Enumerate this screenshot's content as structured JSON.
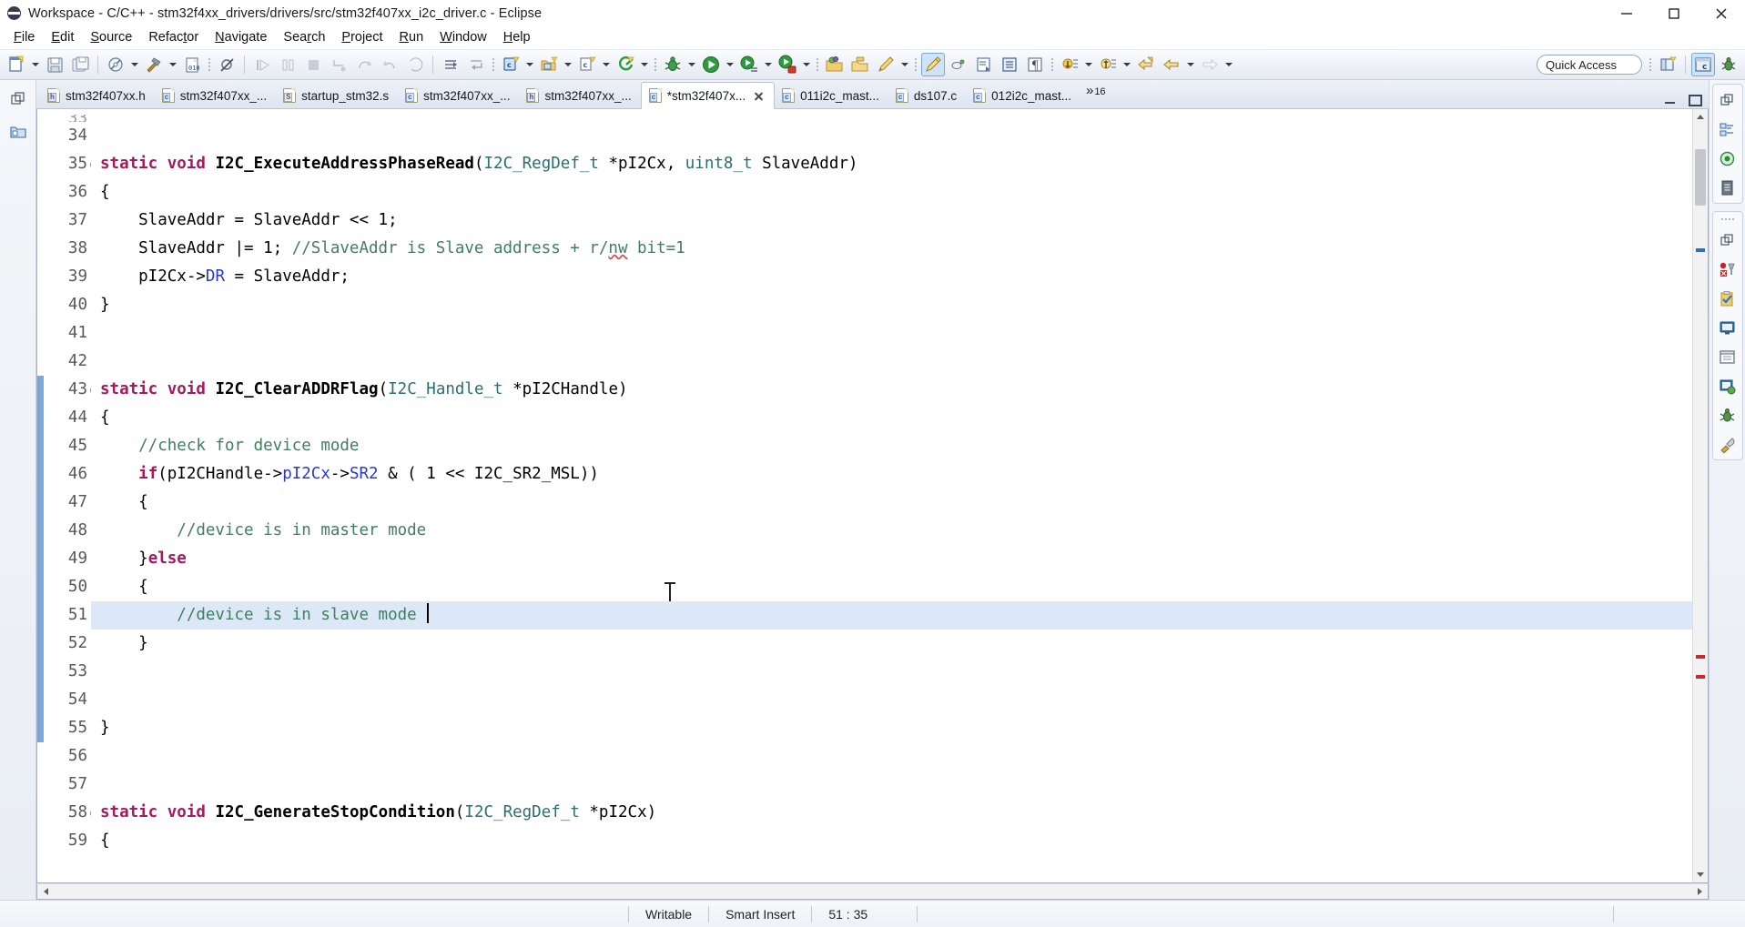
{
  "window": {
    "title": "Workspace - C/C++ - stm32f4xx_drivers/drivers/src/stm32f407xx_i2c_driver.c - Eclipse",
    "app_icon": "eclipse-icon",
    "controls": {
      "minimize": "minimize-button",
      "maximize": "maximize-button",
      "close": "close-button"
    }
  },
  "menubar": {
    "items": [
      {
        "label": "File",
        "mnemonic": "F"
      },
      {
        "label": "Edit",
        "mnemonic": "E"
      },
      {
        "label": "Source",
        "mnemonic": "S"
      },
      {
        "label": "Refactor",
        "mnemonic": "t"
      },
      {
        "label": "Navigate",
        "mnemonic": "N"
      },
      {
        "label": "Search",
        "mnemonic": "r"
      },
      {
        "label": "Project",
        "mnemonic": "P"
      },
      {
        "label": "Run",
        "mnemonic": "R"
      },
      {
        "label": "Window",
        "mnemonic": "W"
      },
      {
        "label": "Help",
        "mnemonic": "H"
      }
    ]
  },
  "toolbar": {
    "quick_access_label": "Quick Access",
    "buttons": [
      {
        "name": "new-wizard",
        "icon": "new-file-icon",
        "dropdown": true,
        "enabled": true
      },
      {
        "name": "save",
        "icon": "save-icon",
        "dropdown": false,
        "enabled": true
      },
      {
        "name": "save-all",
        "icon": "save-all-icon",
        "dropdown": false,
        "enabled": true
      },
      {
        "name": "build-all",
        "icon": "build-all-icon",
        "dropdown": true,
        "enabled": true
      },
      {
        "name": "build-project",
        "icon": "hammer-icon",
        "dropdown": true,
        "enabled": true
      },
      {
        "name": "binary-view",
        "icon": "binary-icon",
        "dropdown": false,
        "enabled": true
      },
      {
        "name": "skip-breakpoints",
        "icon": "skip-breakpoints-icon",
        "dropdown": false,
        "enabled": true
      },
      {
        "name": "resume",
        "icon": "resume-icon",
        "dropdown": false,
        "enabled": false
      },
      {
        "name": "suspend",
        "icon": "suspend-icon",
        "dropdown": false,
        "enabled": false
      },
      {
        "name": "terminate",
        "icon": "terminate-icon",
        "dropdown": false,
        "enabled": false
      },
      {
        "name": "step-into",
        "icon": "step-into-icon",
        "dropdown": false,
        "enabled": false
      },
      {
        "name": "step-over",
        "icon": "step-over-icon",
        "dropdown": false,
        "enabled": false
      },
      {
        "name": "step-return",
        "icon": "step-return-icon",
        "dropdown": false,
        "enabled": false
      },
      {
        "name": "drop-to-frame",
        "icon": "drop-to-frame-icon",
        "dropdown": false,
        "enabled": false
      },
      {
        "name": "instruction-stepping",
        "icon": "instruction-icon",
        "dropdown": false,
        "enabled": false
      },
      {
        "name": "new-c-class",
        "icon": "new-c-file-icon",
        "dropdown": true,
        "enabled": true
      },
      {
        "name": "new-c-project",
        "icon": "new-c-project-icon",
        "dropdown": true,
        "enabled": true
      },
      {
        "name": "new-c-source",
        "icon": "new-c-source-icon",
        "dropdown": true,
        "enabled": true
      },
      {
        "name": "run-last-tool",
        "icon": "external-tools-icon",
        "dropdown": true,
        "enabled": true
      },
      {
        "name": "debug",
        "icon": "debug-bug-icon",
        "dropdown": true,
        "enabled": true
      },
      {
        "name": "run",
        "icon": "run-icon",
        "dropdown": true,
        "enabled": true
      },
      {
        "name": "run-config",
        "icon": "run-config-icon",
        "dropdown": true,
        "enabled": true
      },
      {
        "name": "coverage",
        "icon": "coverage-icon",
        "dropdown": true,
        "enabled": true
      },
      {
        "name": "open-element",
        "icon": "open-folder-icon",
        "dropdown": false,
        "enabled": true
      },
      {
        "name": "open-type",
        "icon": "open-type-icon",
        "dropdown": false,
        "enabled": true
      },
      {
        "name": "search-marker",
        "icon": "pencil-icon",
        "dropdown": true,
        "enabled": true
      },
      {
        "name": "toggle-mark-occurrences",
        "icon": "highlight-pen-icon",
        "dropdown": false,
        "enabled": true,
        "pressed": true
      },
      {
        "name": "toggle-block-select",
        "icon": "block-select-icon",
        "dropdown": false,
        "enabled": true
      },
      {
        "name": "show-whitespace",
        "icon": "whitespace-icon",
        "dropdown": false,
        "enabled": true
      },
      {
        "name": "show-outline",
        "icon": "outline-icon",
        "dropdown": false,
        "enabled": true
      },
      {
        "name": "toggle-word-wrap",
        "icon": "pilcrow-icon",
        "dropdown": false,
        "enabled": true
      },
      {
        "name": "next-annotation",
        "icon": "next-annotation-icon",
        "dropdown": true,
        "enabled": true
      },
      {
        "name": "prev-annotation",
        "icon": "prev-annotation-icon",
        "dropdown": true,
        "enabled": true
      },
      {
        "name": "last-edit-location",
        "icon": "last-edit-icon",
        "dropdown": false,
        "enabled": true
      },
      {
        "name": "back",
        "icon": "back-arrow-icon",
        "dropdown": true,
        "enabled": true
      },
      {
        "name": "forward",
        "icon": "forward-arrow-icon",
        "dropdown": true,
        "enabled": false
      }
    ],
    "perspective": [
      {
        "name": "open-perspective",
        "icon": "open-perspective-icon"
      },
      {
        "name": "perspective-cpp",
        "icon": "cpp-perspective-icon",
        "active": true
      },
      {
        "name": "perspective-debug",
        "icon": "debug-perspective-icon"
      }
    ]
  },
  "left_fastview": {
    "buttons": [
      {
        "name": "restore-view",
        "icon": "restore-icon"
      },
      {
        "name": "project-explorer-fastview",
        "icon": "project-explorer-icon"
      }
    ]
  },
  "tabs": {
    "items": [
      {
        "label": "stm32f407xx.h",
        "kind": "h",
        "active": false,
        "dirty": false
      },
      {
        "label": "stm32f407xx_...",
        "kind": "c",
        "active": false,
        "dirty": false
      },
      {
        "label": "startup_stm32.s",
        "kind": "s",
        "active": false,
        "dirty": false
      },
      {
        "label": "stm32f407xx_...",
        "kind": "c",
        "active": false,
        "dirty": false
      },
      {
        "label": "stm32f407xx_...",
        "kind": "h",
        "active": false,
        "dirty": false
      },
      {
        "label": "*stm32f407x...",
        "kind": "c",
        "active": true,
        "dirty": true
      },
      {
        "label": "011i2c_mast...",
        "kind": "c",
        "active": false,
        "dirty": false
      },
      {
        "label": "ds107.c",
        "kind": "c",
        "active": false,
        "dirty": false
      },
      {
        "label": "012i2c_mast...",
        "kind": "c",
        "active": false,
        "dirty": false
      }
    ],
    "overflow_symbol": "»",
    "overflow_count": "16",
    "minimize": "minimize-editor-icon",
    "maximize": "maximize-editor-icon"
  },
  "editor": {
    "first_visible_partial_line": "33",
    "cursor_line": 51,
    "highlighted_line": 51,
    "lines": [
      {
        "num": "34",
        "fold": false,
        "changed": false,
        "tokens": []
      },
      {
        "num": "35",
        "fold": true,
        "changed": false,
        "tokens": [
          {
            "t": "static",
            "c": "kw"
          },
          {
            "t": " ",
            "c": "pln"
          },
          {
            "t": "void",
            "c": "kw"
          },
          {
            "t": " ",
            "c": "pln"
          },
          {
            "t": "I2C_ExecuteAddressPhaseRead",
            "c": "fn"
          },
          {
            "t": "(",
            "c": "pln"
          },
          {
            "t": "I2C_RegDef_t",
            "c": "typ"
          },
          {
            "t": " *pI2Cx, ",
            "c": "pln"
          },
          {
            "t": "uint8_t",
            "c": "typ"
          },
          {
            "t": " SlaveAddr)",
            "c": "pln"
          }
        ]
      },
      {
        "num": "36",
        "fold": false,
        "changed": false,
        "tokens": [
          {
            "t": "{",
            "c": "pln"
          }
        ]
      },
      {
        "num": "37",
        "fold": false,
        "changed": false,
        "tokens": [
          {
            "t": "    SlaveAddr = SlaveAddr << 1;",
            "c": "pln"
          }
        ]
      },
      {
        "num": "38",
        "fold": false,
        "changed": false,
        "tokens": [
          {
            "t": "    SlaveAddr |= 1; ",
            "c": "pln"
          },
          {
            "t": "//SlaveAddr is Slave address + r/",
            "c": "cmt"
          },
          {
            "t": "nw",
            "c": "cmt",
            "spell": true
          },
          {
            "t": " bit=1",
            "c": "cmt"
          }
        ]
      },
      {
        "num": "39",
        "fold": false,
        "changed": false,
        "tokens": [
          {
            "t": "    pI2Cx->",
            "c": "pln"
          },
          {
            "t": "DR",
            "c": "fld"
          },
          {
            "t": " = SlaveAddr;",
            "c": "pln"
          }
        ]
      },
      {
        "num": "40",
        "fold": false,
        "changed": false,
        "tokens": [
          {
            "t": "}",
            "c": "pln"
          }
        ]
      },
      {
        "num": "41",
        "fold": false,
        "changed": false,
        "tokens": []
      },
      {
        "num": "42",
        "fold": false,
        "changed": false,
        "tokens": []
      },
      {
        "num": "43",
        "fold": true,
        "changed": true,
        "tokens": [
          {
            "t": "static",
            "c": "kw"
          },
          {
            "t": " ",
            "c": "pln"
          },
          {
            "t": "void",
            "c": "kw"
          },
          {
            "t": " ",
            "c": "pln"
          },
          {
            "t": "I2C_ClearADDRFlag",
            "c": "fn"
          },
          {
            "t": "(",
            "c": "pln"
          },
          {
            "t": "I2C_Handle_t",
            "c": "typ"
          },
          {
            "t": " *pI2CHandle)",
            "c": "pln"
          }
        ]
      },
      {
        "num": "44",
        "fold": false,
        "changed": true,
        "tokens": [
          {
            "t": "{",
            "c": "pln"
          }
        ]
      },
      {
        "num": "45",
        "fold": false,
        "changed": true,
        "tokens": [
          {
            "t": "    //check for device mode",
            "c": "cmt"
          }
        ]
      },
      {
        "num": "46",
        "fold": false,
        "changed": true,
        "tokens": [
          {
            "t": "    ",
            "c": "pln"
          },
          {
            "t": "if",
            "c": "kw"
          },
          {
            "t": "(pI2CHandle->",
            "c": "pln"
          },
          {
            "t": "pI2Cx",
            "c": "fld"
          },
          {
            "t": "->",
            "c": "pln"
          },
          {
            "t": "SR2",
            "c": "fld"
          },
          {
            "t": " & ( 1 << I2C_SR2_MSL))",
            "c": "pln"
          }
        ]
      },
      {
        "num": "47",
        "fold": false,
        "changed": true,
        "tokens": [
          {
            "t": "    {",
            "c": "pln"
          }
        ]
      },
      {
        "num": "48",
        "fold": false,
        "changed": true,
        "tokens": [
          {
            "t": "        //device is in master mode",
            "c": "cmt"
          }
        ]
      },
      {
        "num": "49",
        "fold": false,
        "changed": true,
        "tokens": [
          {
            "t": "    }",
            "c": "pln"
          },
          {
            "t": "else",
            "c": "kw"
          }
        ]
      },
      {
        "num": "50",
        "fold": false,
        "changed": true,
        "tokens": [
          {
            "t": "    {",
            "c": "pln"
          }
        ]
      },
      {
        "num": "51",
        "fold": false,
        "changed": true,
        "highlight": true,
        "caret_after": true,
        "tokens": [
          {
            "t": "        //device is in slave mode ",
            "c": "cmt"
          }
        ]
      },
      {
        "num": "52",
        "fold": false,
        "changed": true,
        "tokens": [
          {
            "t": "    }",
            "c": "pln"
          }
        ]
      },
      {
        "num": "53",
        "fold": false,
        "changed": true,
        "tokens": []
      },
      {
        "num": "54",
        "fold": false,
        "changed": true,
        "tokens": []
      },
      {
        "num": "55",
        "fold": false,
        "changed": true,
        "tokens": [
          {
            "t": "}",
            "c": "pln"
          }
        ]
      },
      {
        "num": "56",
        "fold": false,
        "changed": false,
        "tokens": []
      },
      {
        "num": "57",
        "fold": false,
        "changed": false,
        "tokens": []
      },
      {
        "num": "58",
        "fold": true,
        "changed": false,
        "tokens": [
          {
            "t": "static",
            "c": "kw"
          },
          {
            "t": " ",
            "c": "pln"
          },
          {
            "t": "void",
            "c": "kw"
          },
          {
            "t": " ",
            "c": "pln"
          },
          {
            "t": "I2C_GenerateStopCondition",
            "c": "fn"
          },
          {
            "t": "(",
            "c": "pln"
          },
          {
            "t": "I2C_RegDef_t",
            "c": "typ"
          },
          {
            "t": " *pI2Cx)",
            "c": "pln"
          }
        ]
      },
      {
        "num": "59",
        "fold": false,
        "changed": false,
        "tokens": [
          {
            "t": "{",
            "c": "pln"
          }
        ]
      }
    ]
  },
  "right_fastview": {
    "group_a": [
      {
        "name": "restore-view",
        "icon": "restore-icon"
      },
      {
        "name": "outline-view",
        "icon": "outline-view-icon"
      },
      {
        "name": "build-targets-view",
        "icon": "build-targets-icon"
      },
      {
        "name": "make-target-view",
        "icon": "documents-icon"
      }
    ],
    "group_b": [
      {
        "name": "restore-view-2",
        "icon": "restore-icon"
      },
      {
        "name": "breakpoints-view",
        "icon": "breakpoints-icon"
      },
      {
        "name": "tasks-view",
        "icon": "tasks-clipboard-icon"
      },
      {
        "name": "console-view",
        "icon": "console-monitor-icon"
      },
      {
        "name": "properties-view",
        "icon": "properties-window-icon"
      },
      {
        "name": "problems-view",
        "icon": "problems-icon"
      },
      {
        "name": "debug-view",
        "icon": "debug-bug-icon"
      },
      {
        "name": "memory-view",
        "icon": "memory-wrench-icon"
      }
    ]
  },
  "statusbar": {
    "writable": "Writable",
    "insert_mode": "Smart Insert",
    "position": "51 : 35",
    "lock_icon": "editor-lock-icon",
    "right_icons": [
      {
        "name": "progress-icon"
      },
      {
        "name": "notes-icon"
      },
      {
        "name": "window-icon"
      },
      {
        "name": "dot-icon"
      }
    ]
  }
}
